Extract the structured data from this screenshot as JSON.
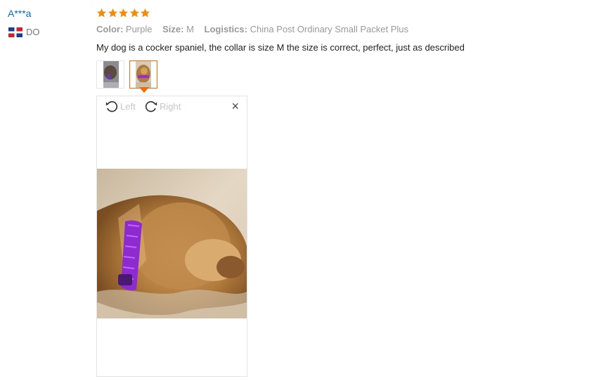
{
  "reviewer": {
    "name": "A***a",
    "country_code": "DO",
    "flag_icon": "dominican-republic-flag-icon"
  },
  "rating": {
    "stars": 5,
    "max": 5,
    "color": "#f58a07"
  },
  "attributes": {
    "color_label": "Color:",
    "color_value": "Purple",
    "size_label": "Size:",
    "size_value": "M",
    "logistics_label": "Logistics:",
    "logistics_value": "China Post Ordinary Small Packet Plus"
  },
  "review_text": "My dog is a cocker spaniel, the collar is size M the size is correct, perfect, just as described",
  "thumbnails": [
    {
      "name": "photo-thumbnail-1",
      "selected": false
    },
    {
      "name": "photo-thumbnail-2",
      "selected": true
    }
  ],
  "viewer": {
    "rotate_left_label": "Left",
    "rotate_right_label": "Right",
    "rotate_left_icon": "rotate-left-icon",
    "rotate_right_icon": "rotate-right-icon",
    "close_icon": "close-icon",
    "close_glyph": "×"
  },
  "colors": {
    "link": "#0a6ebd",
    "accent": "#f06b00",
    "muted": "#999999"
  }
}
